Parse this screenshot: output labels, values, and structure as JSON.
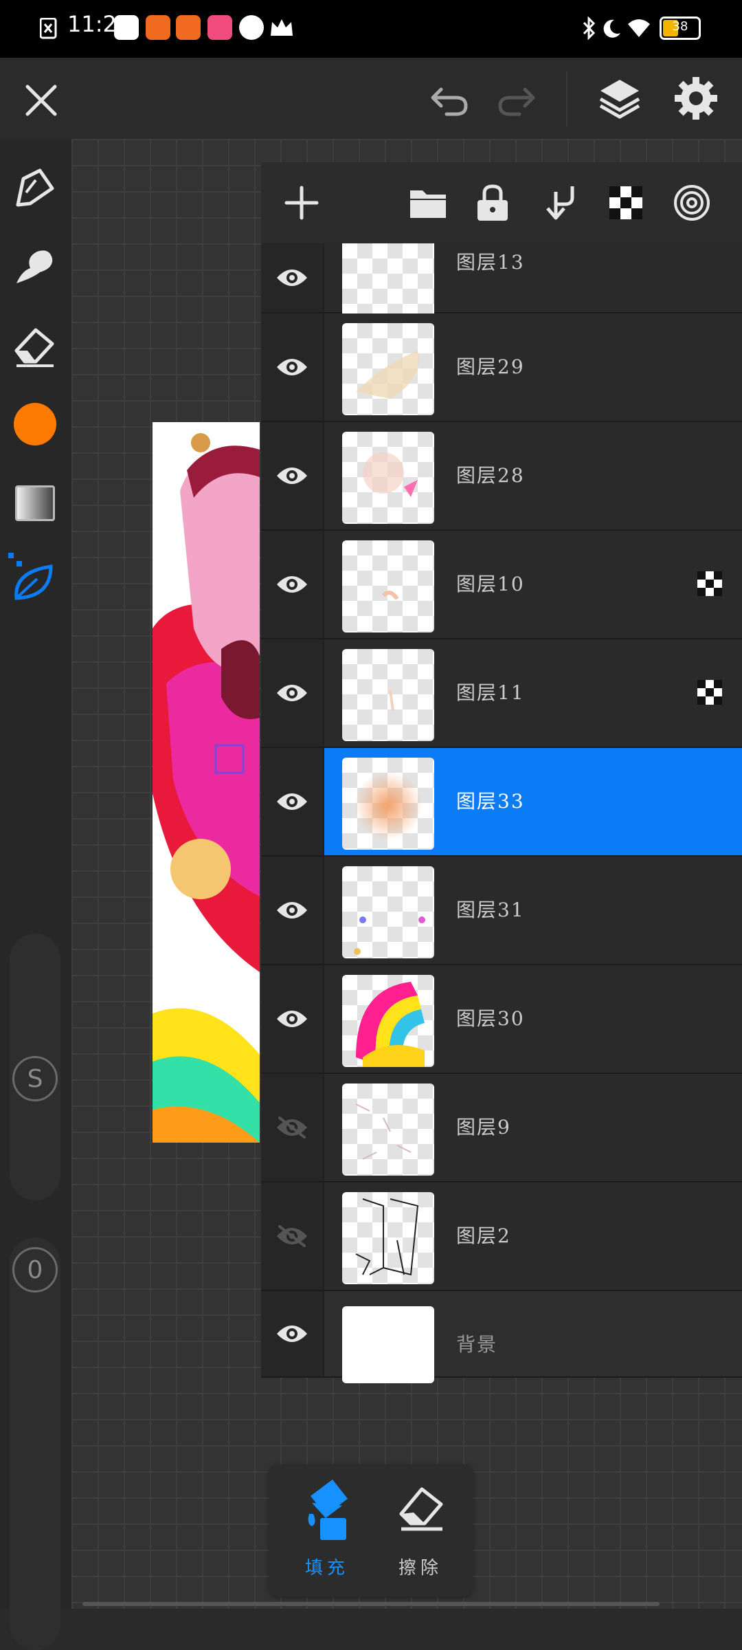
{
  "status_bar": {
    "time": "11:22",
    "battery": "38",
    "icons": [
      "close-notification-icon",
      "scissors-app-icon",
      "orange-app-icon",
      "orange-app-icon",
      "pink-app-icon",
      "q-app-icon",
      "crown-icon",
      "bluetooth-icon",
      "moon-icon",
      "wifi-icon",
      "battery-icon"
    ]
  },
  "top_bar": {
    "icons": [
      "close-icon",
      "undo-icon",
      "redo-icon",
      "layers-icon",
      "settings-icon"
    ]
  },
  "left_tools": {
    "icons": [
      "pen-icon",
      "smudge-icon",
      "eraser-icon",
      "color-swatch",
      "gradient-icon",
      "leaf-brush-icon"
    ],
    "color": "#ff7a00",
    "size_knob_label": "S",
    "opacity_knob_label": "0"
  },
  "layer_toolbar": {
    "icons": [
      "add-icon",
      "folder-icon",
      "lock-icon",
      "merge-down-icon",
      "checker-icon",
      "target-icon"
    ]
  },
  "layers": [
    {
      "name": "图层13",
      "visible": true,
      "ref": false,
      "selected": false
    },
    {
      "name": "图层29",
      "visible": true,
      "ref": false,
      "selected": false
    },
    {
      "name": "图层28",
      "visible": true,
      "ref": false,
      "selected": false
    },
    {
      "name": "图层10",
      "visible": true,
      "ref": true,
      "selected": false
    },
    {
      "name": "图层11",
      "visible": true,
      "ref": true,
      "selected": false
    },
    {
      "name": "图层33",
      "visible": true,
      "ref": false,
      "selected": true
    },
    {
      "name": "图层31",
      "visible": true,
      "ref": false,
      "selected": false
    },
    {
      "name": "图层30",
      "visible": true,
      "ref": false,
      "selected": false
    },
    {
      "name": "图层9",
      "visible": false,
      "ref": false,
      "selected": false
    },
    {
      "name": "图层2",
      "visible": false,
      "ref": false,
      "selected": false
    },
    {
      "name": "背景",
      "visible": true,
      "ref": false,
      "selected": false
    }
  ],
  "bottom_tools": {
    "fill_label": "填充",
    "erase_label": "擦除"
  },
  "colors": {
    "accent": "#0a7cf5",
    "brush_color": "#ff7a00"
  }
}
